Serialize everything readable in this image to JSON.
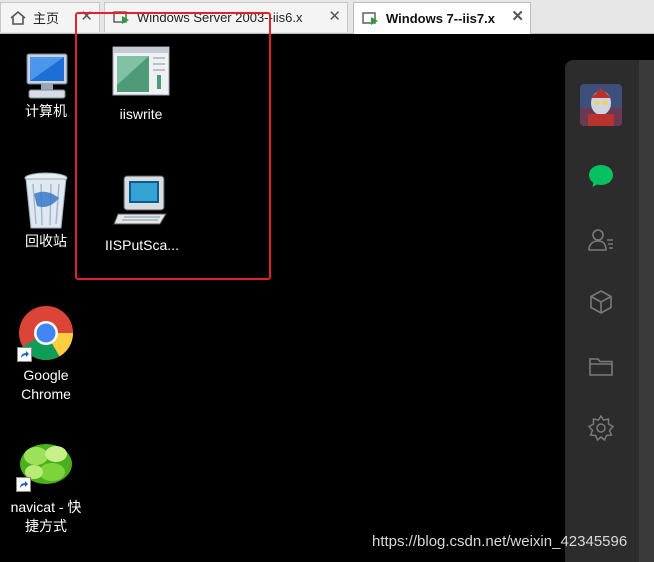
{
  "tabs": [
    {
      "label": "主页",
      "icon": "home-icon",
      "active": false
    },
    {
      "label": "Windows Server 2003--iis6.x",
      "icon": "vm-icon",
      "active": false
    },
    {
      "label": "Windows 7--iis7.x",
      "icon": "vm-icon",
      "active": true
    }
  ],
  "desktop": {
    "icons": {
      "computer": "计算机",
      "recycle": "回收站",
      "chrome_line1": "Google",
      "chrome_line2": "Chrome",
      "navicat_line1": "navicat - 快",
      "navicat_line2": "捷方式",
      "iiswrite": "iiswrite",
      "iisputscan": "IISPutSca..."
    }
  },
  "sidebar": {
    "items": [
      "avatar",
      "chat-icon",
      "contacts-icon",
      "cube-icon",
      "folder-icon",
      "miniprogram-icon"
    ]
  },
  "watermark": "https://blog.csdn.net/weixin_42345596",
  "colors": {
    "highlight": "#e0222a",
    "chat_green": "#07c160",
    "sidebar_bg": "#2c2c2c"
  }
}
